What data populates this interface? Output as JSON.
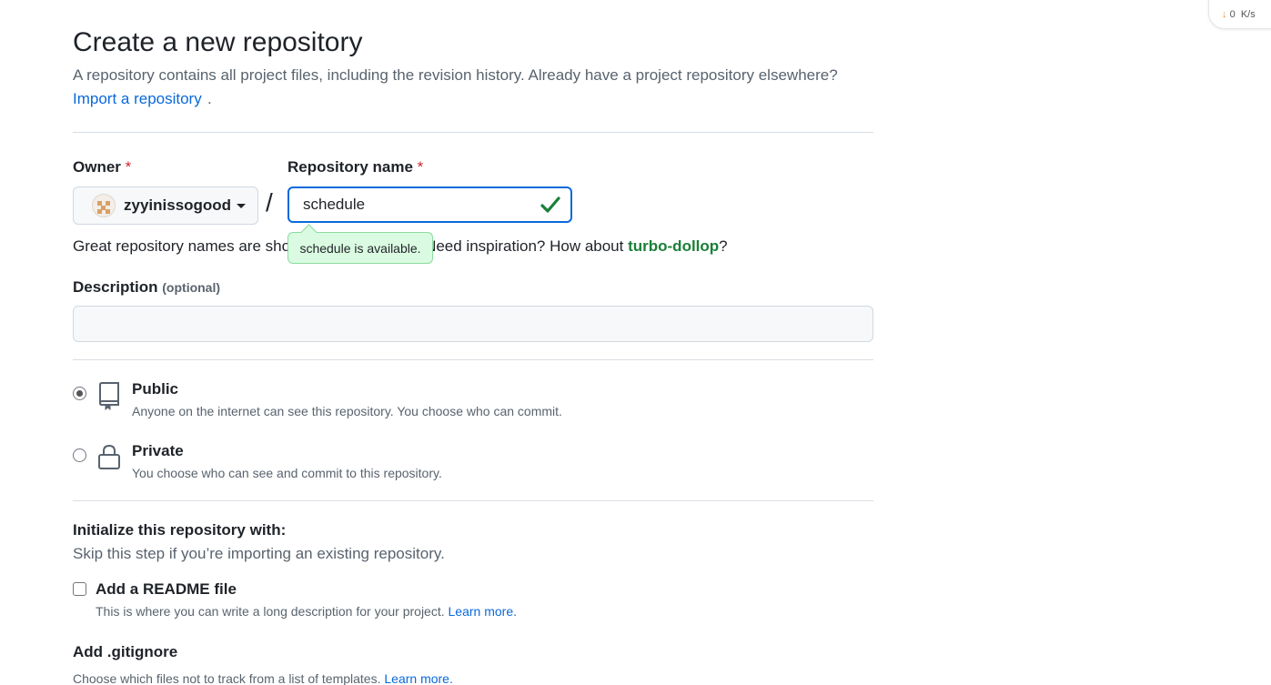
{
  "speed_widget": {
    "upload": "0",
    "download": "0",
    "unit": "K/s"
  },
  "header": {
    "title": "Create a new repository",
    "subtitle": "A repository contains all project files, including the revision history. Already have a project repository elsewhere?",
    "import_link": "Import a repository",
    "import_suffix": "."
  },
  "owner": {
    "label": "Owner",
    "required_mark": "*",
    "value": "zyyinissogood"
  },
  "repo_name": {
    "label": "Repository name",
    "required_mark": "*",
    "value": "schedule",
    "separator": "/",
    "availability_tooltip": "schedule is available."
  },
  "hint": {
    "prefix": "Great repository names are sho",
    "middle": "Need inspiration? How about ",
    "suggestion": "turbo-dollop",
    "suffix": "?"
  },
  "description": {
    "label": "Description",
    "optional": "(optional)",
    "value": ""
  },
  "visibility": {
    "selected": "public",
    "options": [
      {
        "title": "Public",
        "desc": "Anyone on the internet can see this repository. You choose who can commit.",
        "icon": "repo-icon"
      },
      {
        "title": "Private",
        "desc": "You choose who can see and commit to this repository.",
        "icon": "lock-icon"
      }
    ]
  },
  "initialize": {
    "title": "Initialize this repository with:",
    "subtitle": "Skip this step if you’re importing an existing repository.",
    "readme": {
      "label": "Add a README file",
      "checked": false,
      "desc": "This is where you can write a long description for your project.",
      "learn_more": "Learn more."
    },
    "gitignore": {
      "title": "Add .gitignore",
      "desc": "Choose which files not to track from a list of templates.",
      "learn_more": "Learn more."
    }
  },
  "colors": {
    "accent": "#0969da",
    "success": "#1a7f37",
    "required": "#d1242f"
  }
}
